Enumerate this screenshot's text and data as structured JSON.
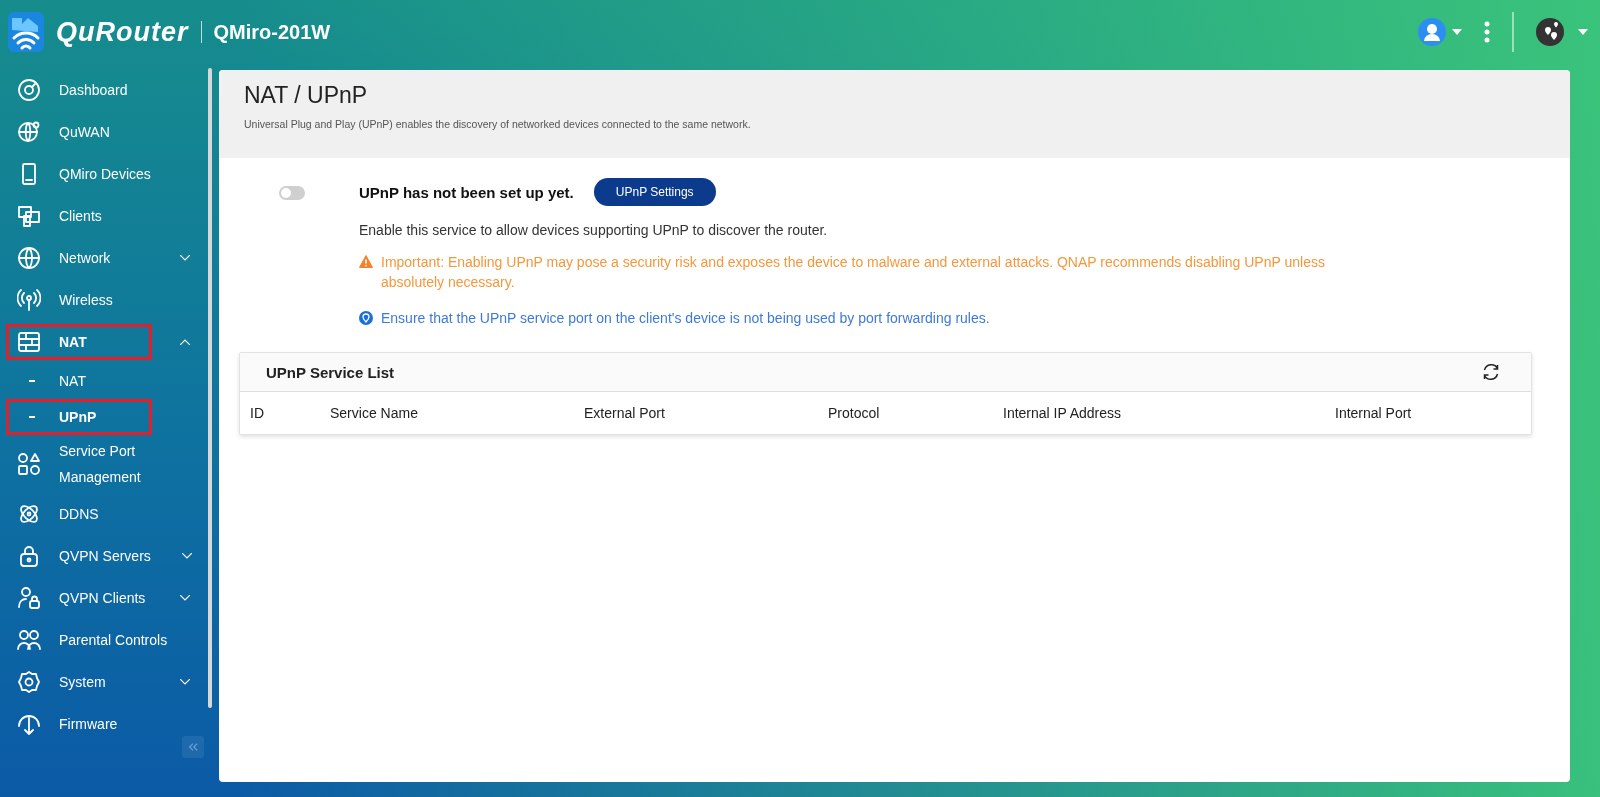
{
  "header": {
    "brand": "QuRouter",
    "device": "QMiro-201W"
  },
  "sidebar": {
    "items": [
      {
        "label": "Dashboard",
        "kind": "link",
        "selected": false,
        "highlighted": false
      },
      {
        "label": "QuWAN",
        "kind": "link",
        "selected": false,
        "highlighted": false
      },
      {
        "label": "QMiro Devices",
        "kind": "link",
        "selected": false,
        "highlighted": false
      },
      {
        "label": "Clients",
        "kind": "link",
        "selected": false,
        "highlighted": false
      },
      {
        "label": "Network",
        "kind": "group",
        "expanded": false,
        "selected": false,
        "highlighted": false
      },
      {
        "label": "Wireless",
        "kind": "link",
        "selected": false,
        "highlighted": false
      },
      {
        "label": "NAT",
        "kind": "group",
        "expanded": true,
        "selected": true,
        "highlighted": true,
        "children": [
          {
            "label": "NAT",
            "selected": false,
            "highlighted": false
          },
          {
            "label": "UPnP",
            "selected": true,
            "highlighted": true
          }
        ]
      },
      {
        "label": "Service Port Management",
        "kind": "link",
        "selected": false,
        "highlighted": false
      },
      {
        "label": "DDNS",
        "kind": "link",
        "selected": false,
        "highlighted": false
      },
      {
        "label": "QVPN Servers",
        "kind": "group",
        "expanded": false,
        "selected": false,
        "highlighted": false
      },
      {
        "label": "QVPN Clients",
        "kind": "group",
        "expanded": false,
        "selected": false,
        "highlighted": false
      },
      {
        "label": "Parental Controls",
        "kind": "link",
        "selected": false,
        "highlighted": false
      },
      {
        "label": "System",
        "kind": "group",
        "expanded": false,
        "selected": false,
        "highlighted": false
      },
      {
        "label": "Firmware",
        "kind": "link",
        "selected": false,
        "highlighted": false
      }
    ]
  },
  "page": {
    "title": "NAT / UPnP",
    "subtitle": "Universal Plug and Play (UPnP) enables the discovery of networked devices connected to the same network."
  },
  "upnp": {
    "enabled": false,
    "status": "UPnP has not been set up yet.",
    "button": "UPnP Settings",
    "description": "Enable this service to allow devices supporting UPnP to discover the router.",
    "warning": "Important: Enabling UPnP may pose a security risk and exposes the device to malware and external attacks. QNAP recommends disabling UPnP unless absolutely necessary.",
    "note": "Ensure that the UPnP service port on the client's device is not being used by port forwarding rules."
  },
  "service_list": {
    "title": "UPnP Service List",
    "columns": [
      "ID",
      "Service Name",
      "External Port",
      "Protocol",
      "Internal IP Address",
      "Internal Port"
    ]
  }
}
